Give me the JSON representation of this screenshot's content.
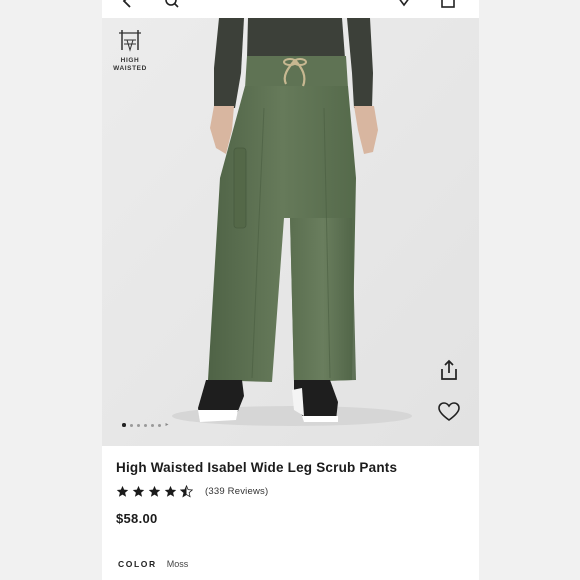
{
  "badge": {
    "line1": "HIGH",
    "line2": "WAISTED",
    "icon": "high-waist-icon"
  },
  "product": {
    "title": "High Waisted Isabel Wide Leg Scrub Pants",
    "rating": 4.5,
    "rating_max": 5,
    "reviews": "(339 Reviews)",
    "price": "$58.00",
    "color_label": "COLOR",
    "color_value": "Moss"
  },
  "gallery": {
    "image_count": 6,
    "active_index": 0
  },
  "colors": {
    "pants": "#5d7152",
    "top": "#3c4039",
    "background": "#e8e8e8",
    "text": "#1b1b1b"
  },
  "icons": [
    "back-icon",
    "search-icon",
    "favorites-icon",
    "bag-icon",
    "share-icon",
    "heart-icon",
    "star-icon"
  ]
}
